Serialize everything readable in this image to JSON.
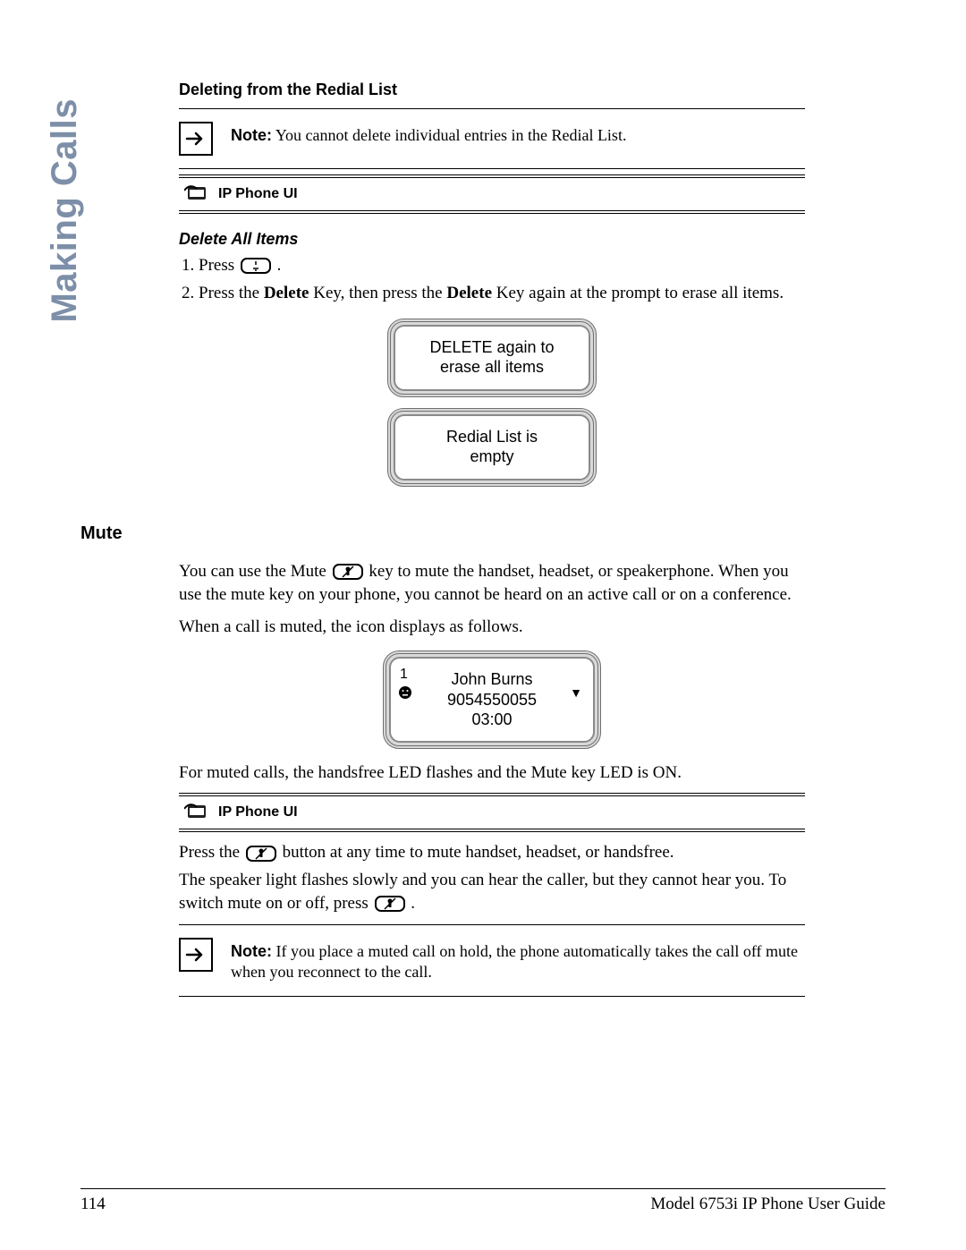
{
  "side_tab": "Making Calls",
  "section1": {
    "title": "Deleting from the Redial List",
    "note_label": "Note:",
    "note_text": "You cannot delete individual entries in the Redial List.",
    "phone_ui_label": "IP Phone UI",
    "delete_all_heading": "Delete All Items",
    "steps": {
      "s1_a": "Press ",
      "s1_b": ".",
      "s2_a": "Press the ",
      "s2_delete": "Delete",
      "s2_b": " Key, then press the ",
      "s2_c": " Key again at the prompt to erase all items."
    },
    "lcd1_line1": "DELETE again to",
    "lcd1_line2": "erase all items",
    "lcd2_line1": "Redial List is",
    "lcd2_line2": "empty"
  },
  "mute": {
    "heading": "Mute",
    "p1_a": "You can use the Mute ",
    "p1_b": " key to mute the handset, headset, or speakerphone. When you use the mute key on your phone, you cannot be heard on an active call or on a conference.",
    "p2": "When a call is muted, the icon displays as follows.",
    "lcd_line_no": "1",
    "lcd_name": "John Burns",
    "lcd_number": "9054550055",
    "lcd_time": "03:00",
    "p3": "For muted calls, the handsfree LED flashes and the Mute key LED is ON.",
    "phone_ui_label": "IP Phone UI",
    "p4_a": "Press the ",
    "p4_b": " button at any time to mute handset, headset, or handsfree.",
    "p5_a": "The speaker light flashes slowly and you can hear the caller, but they cannot hear you. To switch mute on or off, press ",
    "p5_b": ".",
    "note_label": "Note:",
    "note_text": "If you place a muted call on hold, the phone automatically takes the call off mute when you reconnect to the call."
  },
  "footer": {
    "page_no": "114",
    "guide": "Model 6753i IP Phone User Guide"
  }
}
